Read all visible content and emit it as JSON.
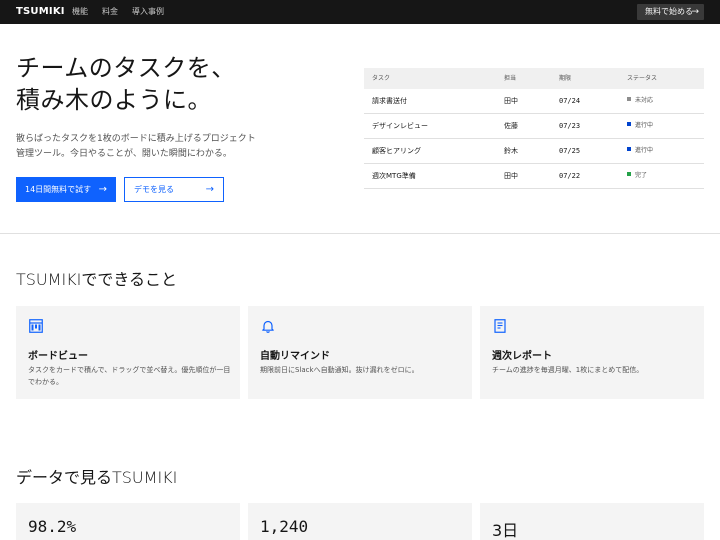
{
  "header": {
    "logo": "TSUMIKI",
    "nav": [
      "機能",
      "料金",
      "導入事例"
    ],
    "cta_label": "無料で始める"
  },
  "hero": {
    "title_line1": "チームのタスクを、",
    "title_line2": "積み木のように。",
    "desc_line1": "散らばったタスクを1枚のボードに積み上げるプロジェクト",
    "desc_line2": "管理ツール。今日やることが、開いた瞬間にわかる。",
    "primary_label": "14日間無料で試す",
    "secondary_label": "デモを見る"
  },
  "task_table": {
    "columns": [
      "タスク",
      "担当",
      "期限",
      "ステータス"
    ],
    "rows": [
      {
        "task": "請求書送付",
        "owner": "田中",
        "due": "07/24",
        "status": "未対応",
        "status_color": "#8d8d8d"
      },
      {
        "task": "デザインレビュー",
        "owner": "佐藤",
        "due": "07/23",
        "status": "進行中",
        "status_color": "#0043ce"
      },
      {
        "task": "顧客ヒアリング",
        "owner": "鈴木",
        "due": "07/25",
        "status": "進行中",
        "status_color": "#0043ce"
      },
      {
        "task": "週次MTG準備",
        "owner": "田中",
        "due": "07/22",
        "status": "完了",
        "status_color": "#24a148"
      }
    ]
  },
  "features": {
    "title": "TSUMIKIでできること",
    "items": [
      {
        "icon": "board-icon",
        "title": "ボードビュー",
        "text": "タスクをカードで積んで、ドラッグで並べ替え。優先順位が一目でわかる。"
      },
      {
        "icon": "bell-icon",
        "title": "自動リマインド",
        "text": "期限前日にSlackへ自動通知。抜け漏れをゼロに。"
      },
      {
        "icon": "report-icon",
        "title": "週次レポート",
        "text": "チームの進捗を毎週月曜、1枚にまとめて配信。"
      }
    ]
  },
  "stats": {
    "title": "データで見るTSUMIKI",
    "items": [
      {
        "value": "98.2%"
      },
      {
        "value": "1,240"
      },
      {
        "value": "3日"
      }
    ]
  },
  "colors": {
    "accent": "#0f62fe",
    "topbar": "#161616"
  }
}
